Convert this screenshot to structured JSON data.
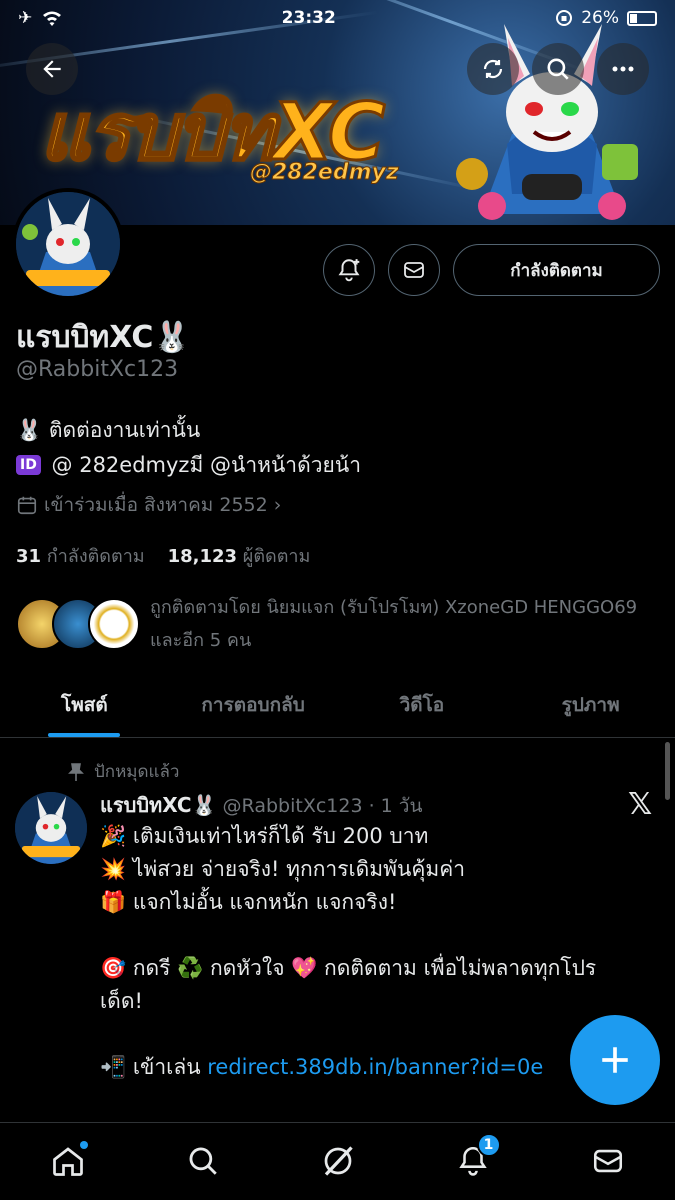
{
  "status": {
    "time": "23:32",
    "battery": "26%"
  },
  "banner": {
    "title": "แรบบิทXC",
    "handle": "@282edmyz"
  },
  "profile": {
    "name": "แรบบิทXC🐰",
    "handle": "@RabbitXc123",
    "bio_line1": "🐰 ติดต่องานเท่านั้น",
    "bio_line2_badge": "ID",
    "bio_line2": "@ 282edmyzมี @นำหน้าด้วยน้า",
    "joined": "เข้าร่วมเมื่อ สิงหาคม 2552",
    "following_count": "31",
    "following_label": "กำลังติดตาม",
    "followers_count": "18,123",
    "followers_label": "ผู้ติดตาม",
    "followed_by": "ถูกติดตามโดย นิยมแจก (รับโปรโมท) XzoneGD HENGGO69 และอีก 5 คน",
    "follow_button": "กำลังติดตาม"
  },
  "tabs": [
    {
      "label": "โพสต์"
    },
    {
      "label": "การตอบกลับ"
    },
    {
      "label": "วิดีโอ"
    },
    {
      "label": "รูปภาพ"
    }
  ],
  "post": {
    "pinned_label": "ปักหมุดแล้ว",
    "author": "แรบบิทXC🐰",
    "meta": "@RabbitXc123 · 1 วัน",
    "lines": [
      "🎉 เติมเงินเท่าไหร่ก็ได้ รับ 200 บาท",
      "💥 ไพ่สวย จ่ายจริง! ทุกการเดิมพันคุ้มค่า",
      "🎁 แจกไม่อั้น แจกหนัก แจกจริง!",
      "",
      "🎯 กดรี ♻️ กดหัวใจ 💖 กดติดตาม เพื่อไม่พลาดทุกโปร",
      "เด็ด!",
      ""
    ],
    "link_prefix": "📲 เข้าเล่น ",
    "link": "redirect.389db.in/banner?id=0e",
    "x_mark": "𝕏"
  },
  "nav": {
    "notification_count": "1"
  },
  "icons": [
    "back-arrow-icon",
    "refresh-icon",
    "search-icon",
    "more-icon",
    "bell-plus-icon",
    "mail-icon",
    "calendar-icon",
    "pin-icon",
    "plus-icon",
    "home-icon",
    "grok-icon",
    "bell-icon"
  ]
}
